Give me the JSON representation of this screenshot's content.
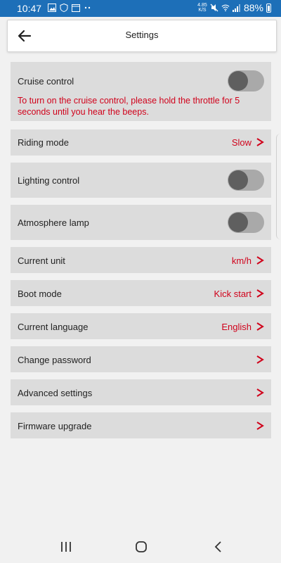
{
  "status_bar": {
    "time": "10:47",
    "net_speed_top": "4.85",
    "net_speed_bottom": "K/S",
    "battery": "88%"
  },
  "header": {
    "title": "Settings"
  },
  "settings": {
    "cruise_control": {
      "label": "Cruise control",
      "toggle_on": false,
      "note": "To turn on the cruise control, please hold the throttle for 5 seconds until you hear the beeps."
    },
    "riding_mode": {
      "label": "Riding mode",
      "value": "Slow"
    },
    "lighting_control": {
      "label": "Lighting control",
      "toggle_on": false
    },
    "atmosphere_lamp": {
      "label": "Atmosphere lamp",
      "toggle_on": false
    },
    "current_unit": {
      "label": "Current unit",
      "value": "km/h"
    },
    "boot_mode": {
      "label": "Boot mode",
      "value": "Kick start"
    },
    "current_language": {
      "label": "Current language",
      "value": "English"
    },
    "change_password": {
      "label": "Change password"
    },
    "advanced_settings": {
      "label": "Advanced settings"
    },
    "firmware_upgrade": {
      "label": "Firmware upgrade"
    }
  },
  "colors": {
    "accent": "#d0021b",
    "status_bar": "#1d6fb8",
    "row_bg": "#dcdcdc"
  }
}
